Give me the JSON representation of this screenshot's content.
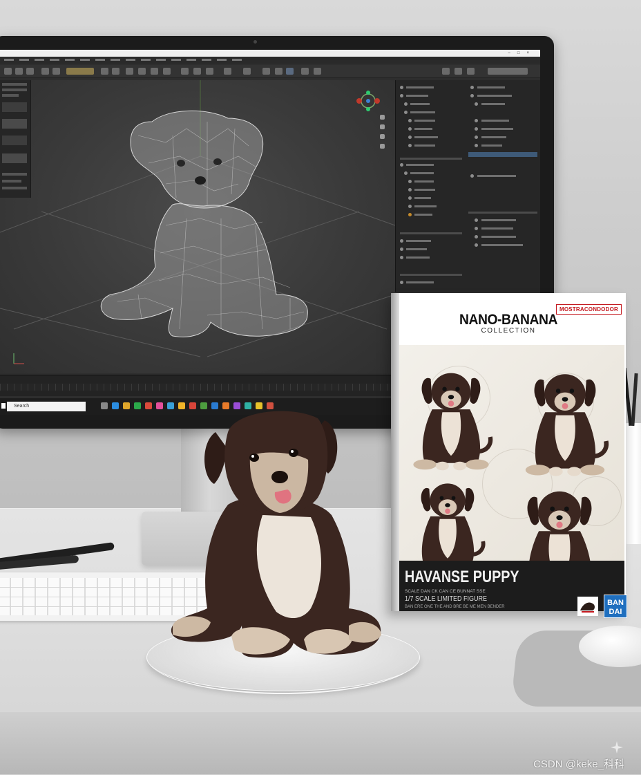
{
  "editor": {
    "title_text": "",
    "taskbar_search_placeholder": "Search"
  },
  "box": {
    "brand_tag": "MOSTRACONDODOR",
    "title": "NANO-BANANA",
    "subtitle": "COLLECTION",
    "product_name": "HAVANSE PUPPY",
    "line1": "SCALE DAN CK CAN CE BUNNAT SSE",
    "line2": "1/7 SCALE LIMITED FIGURE",
    "line3": "BAN ERE ONE THE AND BRE BE ME MEN BENDER",
    "logo_text": "BAN DAI"
  },
  "watermark": "CSDN @keke_科科",
  "colors": {
    "dog_dark": "#3b2620",
    "dog_light": "#e9ddd0",
    "box_tag_red": "#c4191f",
    "bandai_blue": "#1f6fbf",
    "editor_bg": "#3a3a3a"
  }
}
